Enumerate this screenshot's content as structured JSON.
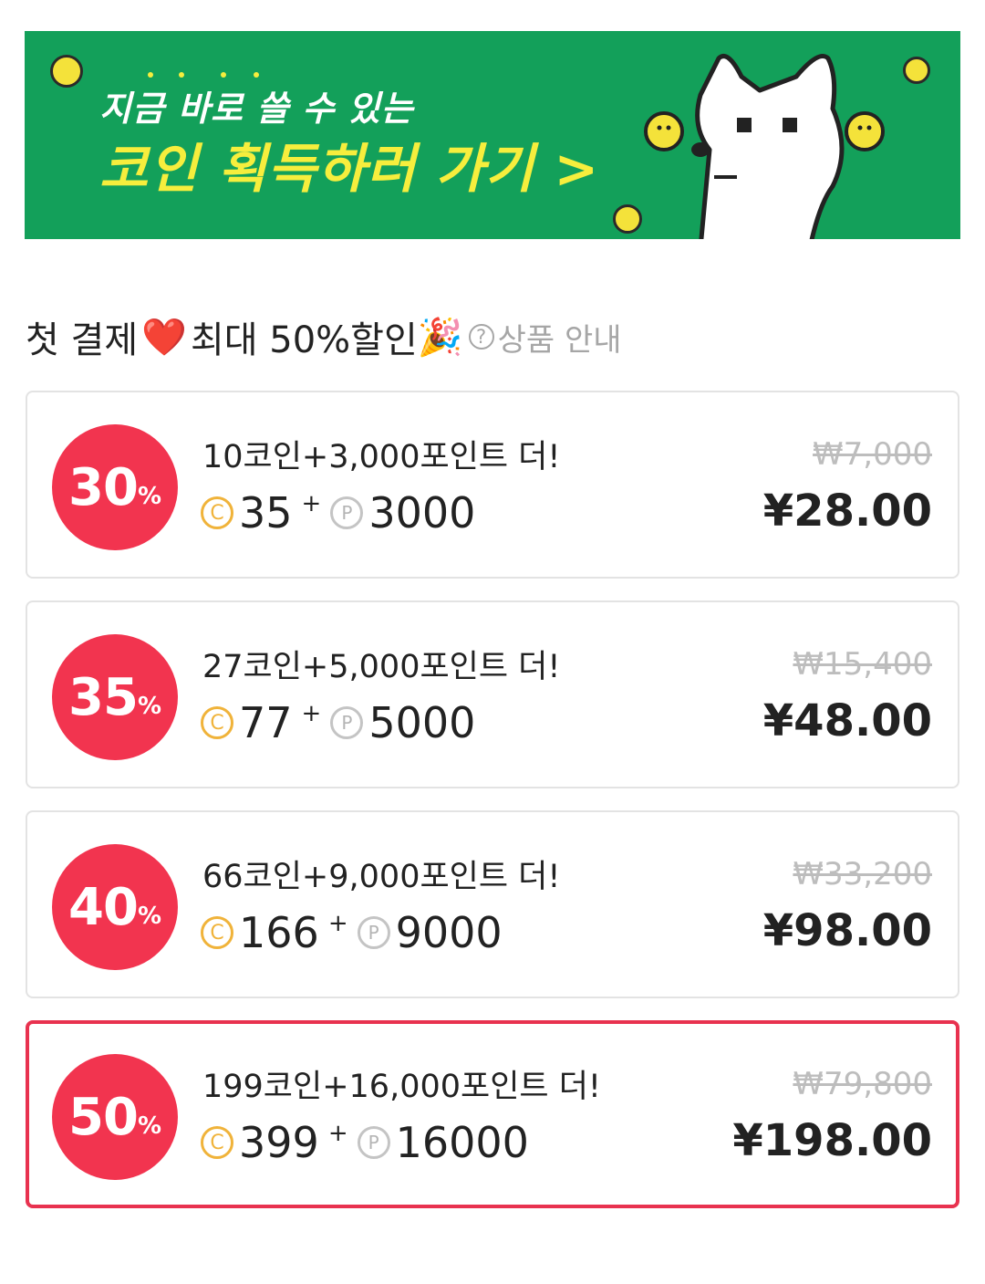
{
  "banner": {
    "line1": "지금 바로 쓸 수 있는",
    "line2": "코인 획득하러 가기 >",
    "background": "#13a05a",
    "headline_color": "#f6ee3d"
  },
  "section": {
    "title_part1": "첫 결제",
    "heart": "❤️",
    "title_part2": "최대 50%할인",
    "party": "🎉",
    "guide_icon": "?",
    "guide_label": "상품 안내"
  },
  "icons": {
    "coin": "C",
    "point": "P",
    "plus": "+"
  },
  "accent_color": "#f2344f",
  "products": [
    {
      "discount": "30",
      "pct": "%",
      "title": "10코인+3,000포인트 더!",
      "coins": "35",
      "points": "3000",
      "original_price": "₩7,000",
      "price": "¥28.00",
      "selected": false
    },
    {
      "discount": "35",
      "pct": "%",
      "title": "27코인+5,000포인트 더!",
      "coins": "77",
      "points": "5000",
      "original_price": "₩15,400",
      "price": "¥48.00",
      "selected": false
    },
    {
      "discount": "40",
      "pct": "%",
      "title": "66코인+9,000포인트 더!",
      "coins": "166",
      "points": "9000",
      "original_price": "₩33,200",
      "price": "¥98.00",
      "selected": false
    },
    {
      "discount": "50",
      "pct": "%",
      "title": "199코인+16,000포인트 더!",
      "coins": "399",
      "points": "16000",
      "original_price": "₩79,800",
      "price": "¥198.00",
      "selected": true
    }
  ]
}
